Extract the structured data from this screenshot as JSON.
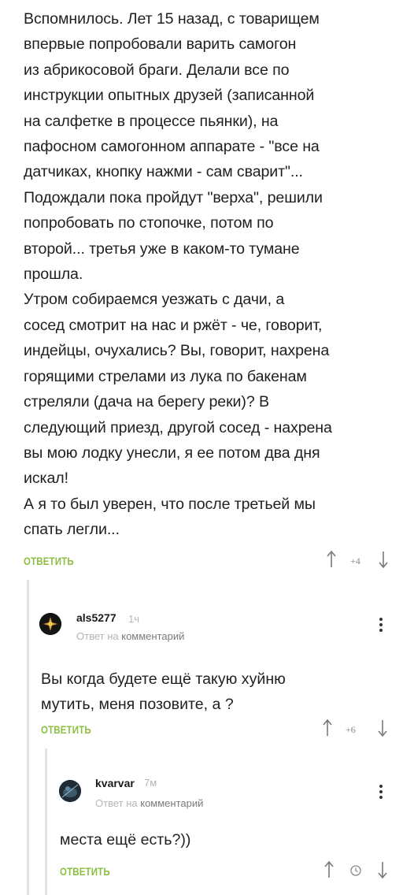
{
  "post": {
    "text": "Вспомнилось. Лет 15 назад, с товарищем\nвпервые попробовали варить самогон\nиз абрикосовой браги. Делали все по\nинструкции опытных друзей (записанной\nна салфетке в процессе пьянки), на\nпафосном самогонном аппарате - \"все на\nдатчиках, кнопку нажми - сам сварит\"...\nПодождали пока пройдут \"верха\", решили\nпопробовать по стопочке, потом по\nвторой... третья уже в каком-то тумане\nпрошла.\nУтром собираемся уезжать с дачи, а\nсосед смотрит на нас и ржёт - че, говорит,\nиндейцы, очухались? Вы, говорит, нахрена\nгорящими стрелами из лука по бакенам\nстреляли (дача на берегу реки)? В\nследующий приезд, другой сосед - нахрена\nвы мою лодку унесли, я ее потом два дня\nискал!\nА я то был уверен, что после третьей мы\nспать легли...",
    "reply_label": "ОТВЕТИТЬ",
    "vote_count": "+4"
  },
  "comments": [
    {
      "username": "als5277",
      "time": "1ч",
      "reply_to_prefix": "Ответ на",
      "reply_to_target": "комментарий",
      "text": "Вы когда будете ещё такую хуйню\nмутить, меня позовите, а ?",
      "reply_label": "ОТВЕТИТЬ",
      "vote_count": "+6"
    },
    {
      "username": "kvarvar",
      "time": "7м",
      "reply_to_prefix": "Ответ на",
      "reply_to_target": "комментарий",
      "text": "места ещё есть?))",
      "reply_label": "ОТВЕТИТЬ",
      "vote_count": ""
    }
  ],
  "colors": {
    "accent": "#8bbf3f",
    "muted": "#b5b5b5",
    "thread_line": "#e3e3e3"
  },
  "icons": {
    "upvote": "arrow-up-icon",
    "downvote": "arrow-down-icon",
    "menu": "more-vertical-icon",
    "pending": "clock-icon"
  }
}
